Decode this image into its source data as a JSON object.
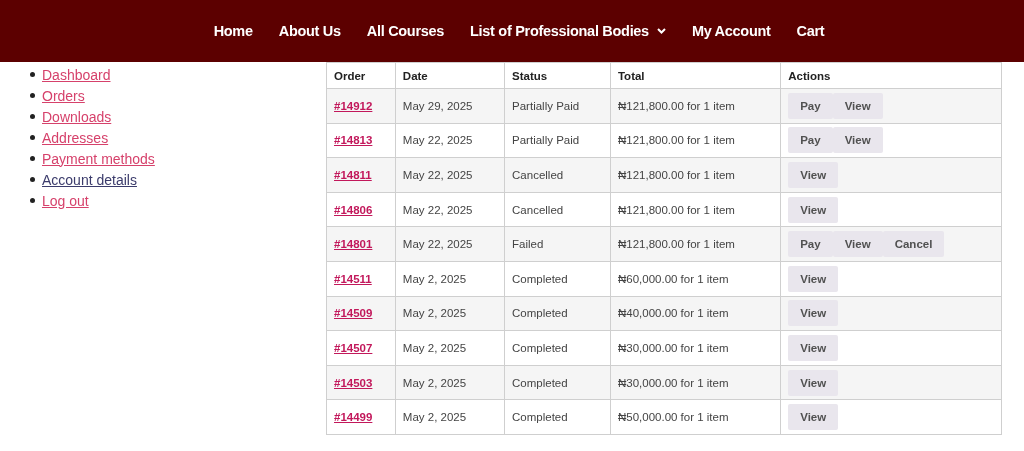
{
  "nav": [
    {
      "label": "Home",
      "dropdown": false
    },
    {
      "label": "About Us",
      "dropdown": false
    },
    {
      "label": "All Courses",
      "dropdown": false
    },
    {
      "label": "List of Professional Bodies",
      "dropdown": true
    },
    {
      "label": "My Account",
      "dropdown": false
    },
    {
      "label": "Cart",
      "dropdown": false
    }
  ],
  "sidebar": {
    "items": [
      {
        "label": "Dashboard",
        "selected": false
      },
      {
        "label": "Orders",
        "selected": false
      },
      {
        "label": "Downloads",
        "selected": false
      },
      {
        "label": "Addresses",
        "selected": false
      },
      {
        "label": "Payment methods",
        "selected": false
      },
      {
        "label": "Account details",
        "selected": true
      },
      {
        "label": "Log out",
        "selected": false
      }
    ]
  },
  "table": {
    "columns": [
      "Order",
      "Date",
      "Status",
      "Total",
      "Actions"
    ],
    "rows": [
      {
        "order": "#14912",
        "date": "May 29, 2025",
        "status": "Partially Paid",
        "total": "₦121,800.00 for 1 item",
        "actions": [
          "Pay",
          "View"
        ]
      },
      {
        "order": "#14813",
        "date": "May 22, 2025",
        "status": "Partially Paid",
        "total": "₦121,800.00 for 1 item",
        "actions": [
          "Pay",
          "View"
        ]
      },
      {
        "order": "#14811",
        "date": "May 22, 2025",
        "status": "Cancelled",
        "total": "₦121,800.00 for 1 item",
        "actions": [
          "View"
        ]
      },
      {
        "order": "#14806",
        "date": "May 22, 2025",
        "status": "Cancelled",
        "total": "₦121,800.00 for 1 item",
        "actions": [
          "View"
        ]
      },
      {
        "order": "#14801",
        "date": "May 22, 2025",
        "status": "Failed",
        "total": "₦121,800.00 for 1 item",
        "actions": [
          "Pay",
          "View",
          "Cancel"
        ]
      },
      {
        "order": "#14511",
        "date": "May 2, 2025",
        "status": "Completed",
        "total": "₦60,000.00 for 1 item",
        "actions": [
          "View"
        ]
      },
      {
        "order": "#14509",
        "date": "May 2, 2025",
        "status": "Completed",
        "total": "₦40,000.00 for 1 item",
        "actions": [
          "View"
        ]
      },
      {
        "order": "#14507",
        "date": "May 2, 2025",
        "status": "Completed",
        "total": "₦30,000.00 for 1 item",
        "actions": [
          "View"
        ]
      },
      {
        "order": "#14503",
        "date": "May 2, 2025",
        "status": "Completed",
        "total": "₦30,000.00 for 1 item",
        "actions": [
          "View"
        ]
      },
      {
        "order": "#14499",
        "date": "May 2, 2025",
        "status": "Completed",
        "total": "₦50,000.00 for 1 item",
        "actions": [
          "View"
        ]
      }
    ]
  }
}
